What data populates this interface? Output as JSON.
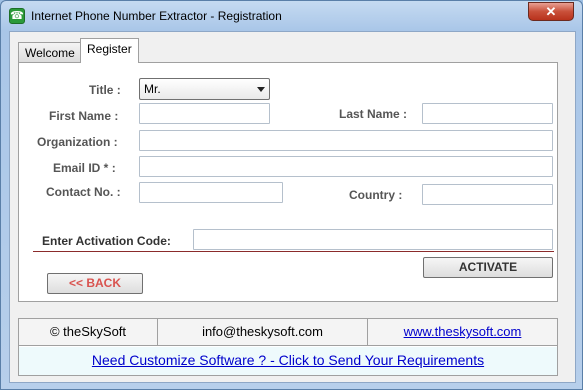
{
  "window": {
    "title": "Internet Phone Number Extractor - Registration",
    "close_glyph": "✕"
  },
  "tabs": [
    {
      "label": "Welcome"
    },
    {
      "label": "Register"
    }
  ],
  "form": {
    "title_label": "Title :",
    "title_value": "Mr.",
    "first_name_label": "First Name :",
    "last_name_label": "Last Name :",
    "organization_label": "Organization :",
    "email_label": "Email ID * :",
    "contact_label": "Contact No. :",
    "country_label": "Country :",
    "activation_label": "Enter Activation Code:",
    "activate_button": "ACTIVATE",
    "back_button": "<< BACK"
  },
  "footer": {
    "copyright": "© theSkySoft",
    "email": "info@theskysoft.com",
    "website": "www.theskysoft.com",
    "banner": "Need Customize Software ? - Click to Send Your Requirements"
  },
  "colors": {
    "back_text": "#d9534f",
    "divider": "#8b2b2b",
    "link": "#0000cc"
  }
}
